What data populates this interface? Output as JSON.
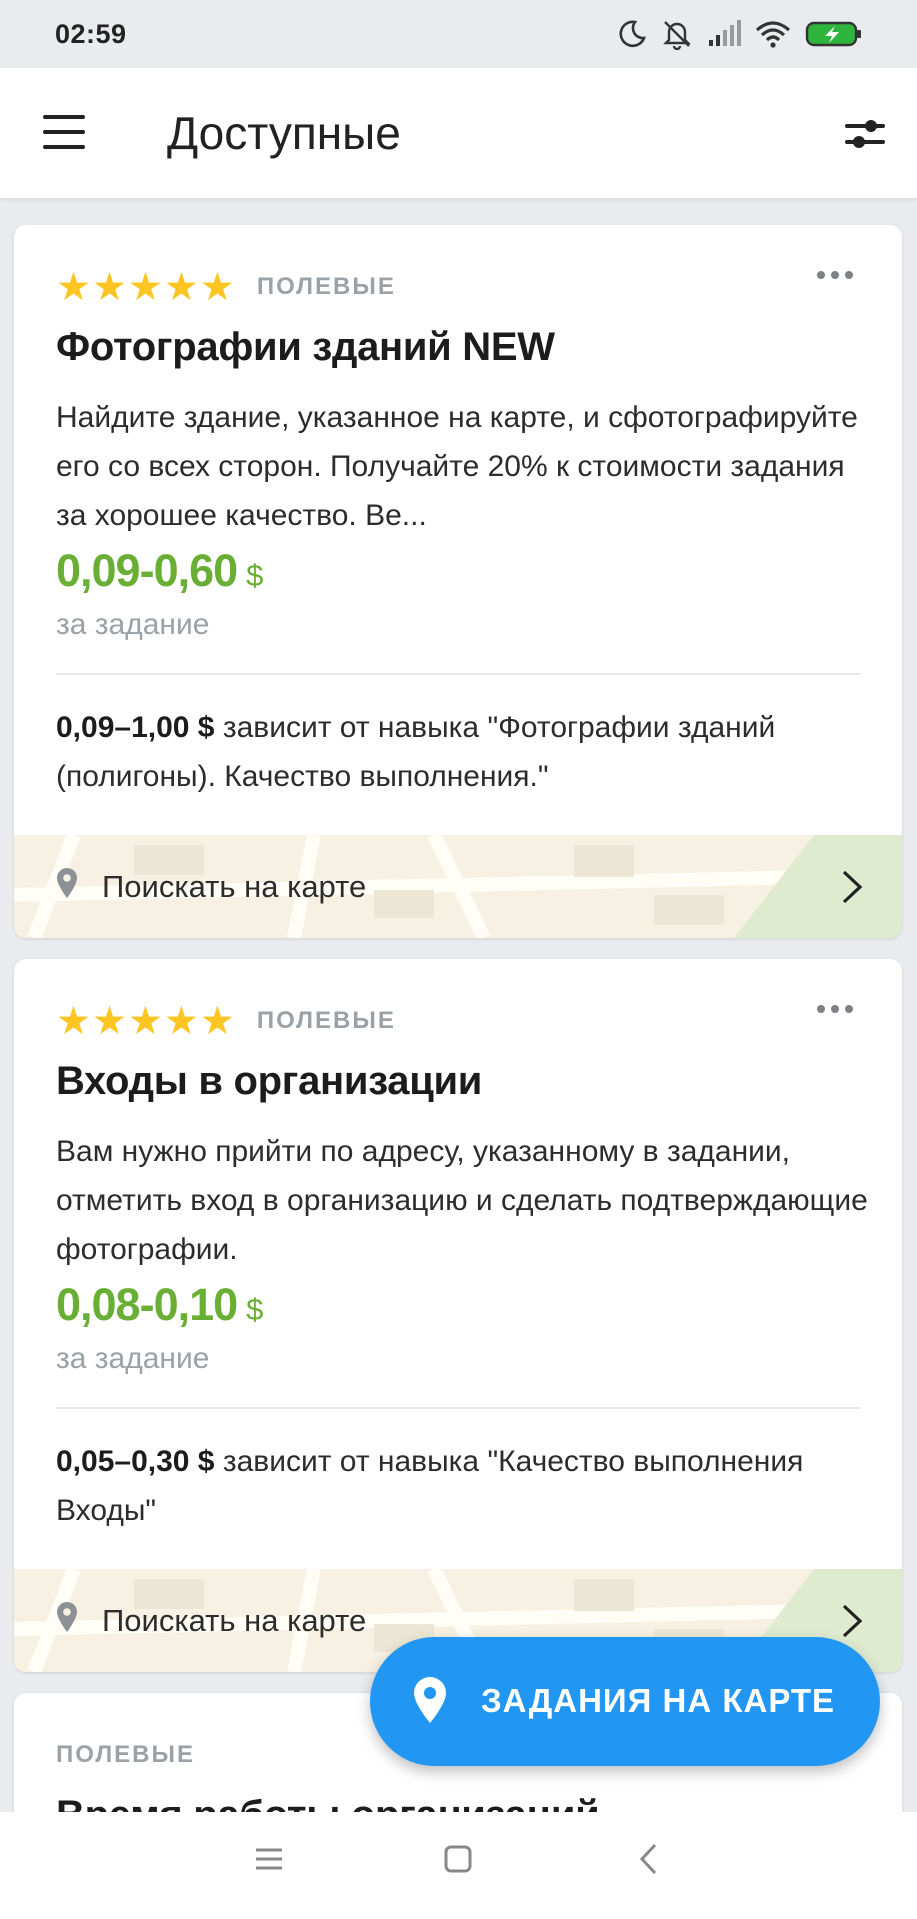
{
  "status_bar": {
    "time": "02:59",
    "icons": [
      "moon-icon",
      "bell-off-icon",
      "signal-icon",
      "wifi-icon",
      "battery-charging-icon"
    ],
    "battery_color": "#2fb53d"
  },
  "header": {
    "title": "Доступные",
    "menu_icon": "hamburger-menu-icon",
    "filter_icon": "filter-sliders-icon"
  },
  "colors": {
    "price_green": "#6aaf35",
    "star_yellow": "#fcc521",
    "fab_blue": "#2196f3"
  },
  "cards": [
    {
      "rating_stars": 5,
      "category": "ПОЛЕВЫЕ",
      "title": "Фотографии зданий NEW",
      "description": "Найдите здание, указанное на карте, и сфотографируйте его со всех сторон. Получайте 20% к стоимости задания за хорошее качество. Ве...",
      "price": "0,09-0,60",
      "currency": "$",
      "price_unit": "за задание",
      "skill_range": "0,09–1,00 $",
      "skill_text": " зависит от навыка \"Фотографии зданий (полигоны). Качество выполнения.\"",
      "map_link": "Поискать на карте"
    },
    {
      "rating_stars": 5,
      "category": "ПОЛЕВЫЕ",
      "title": "Входы в организации",
      "description": "Вам нужно прийти по адресу, указанному в задании, отметить вход в организацию и сделать подтверждающие фотографии.",
      "price": "0,08-0,10",
      "currency": "$",
      "price_unit": "за задание",
      "skill_range": "0,05–0,30 $",
      "skill_text": " зависит от навыка \"Качество выполнения Входы\"",
      "map_link": "Поискать на карте"
    },
    {
      "category": "ПОЛЕВЫЕ",
      "title": "Время работы организаций"
    }
  ],
  "fab": {
    "label": "ЗАДАНИЯ НА КАРТЕ",
    "icon": "map-pin-icon"
  },
  "nav_bar": {
    "buttons": [
      "recent-apps-icon",
      "home-icon",
      "back-icon"
    ]
  }
}
